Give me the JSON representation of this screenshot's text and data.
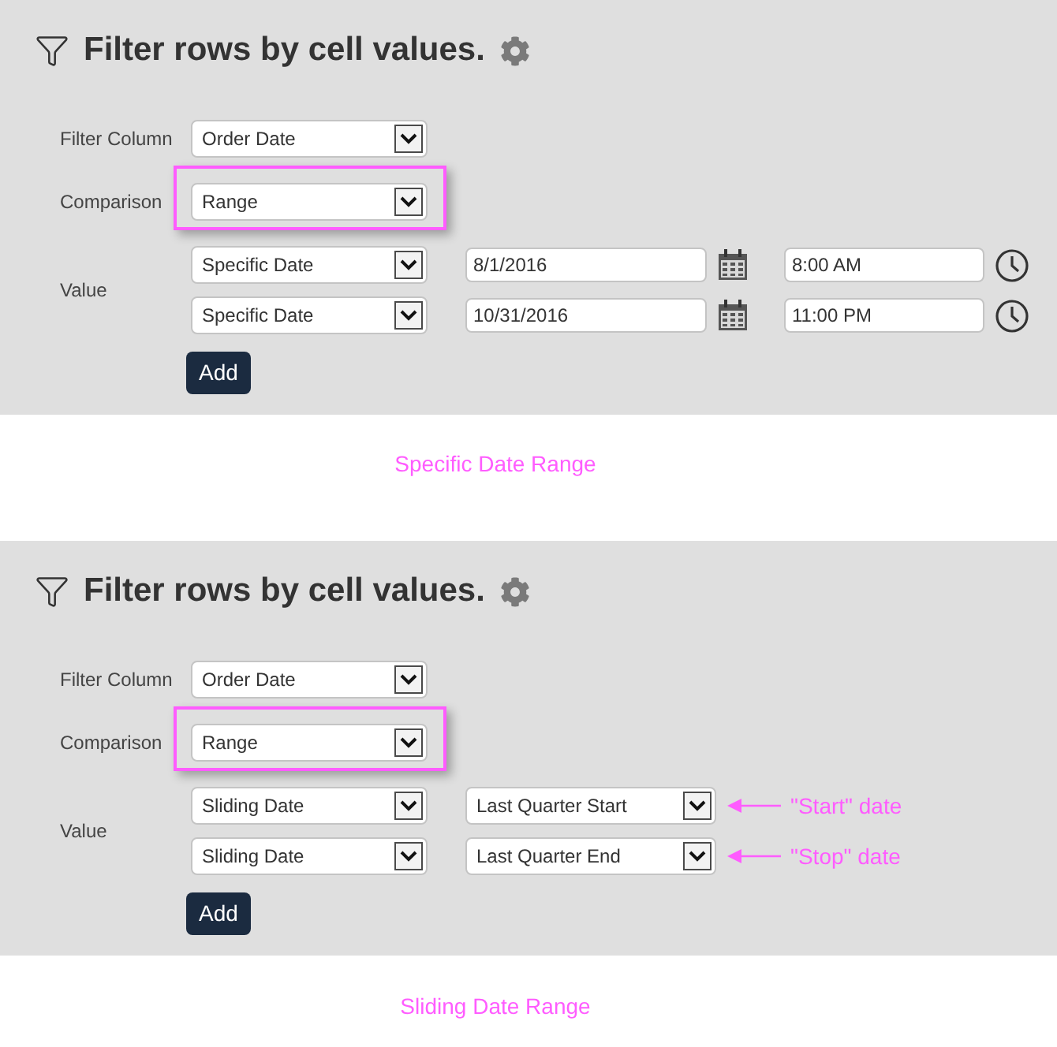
{
  "panels": [
    {
      "title": "Filter rows by cell values.",
      "fields": [
        {
          "label": "Filter Column",
          "value": "Order Date",
          "highlighted": false
        },
        {
          "label": "Comparison",
          "value": "Range",
          "highlighted": true
        }
      ],
      "value": {
        "label": "Value",
        "rows": [
          {
            "kind": "specific",
            "mode": "Specific Date",
            "date": "8/1/2016",
            "time": "8:00 AM"
          },
          {
            "kind": "specific",
            "mode": "Specific Date",
            "date": "10/31/2016",
            "time": "11:00 PM"
          }
        ]
      },
      "add_button": "Add",
      "caption": "Specific Date Range"
    },
    {
      "title": "Filter rows by cell values.",
      "fields": [
        {
          "label": "Filter Column",
          "value": "Order Date",
          "highlighted": false
        },
        {
          "label": "Comparison",
          "value": "Range",
          "highlighted": true
        }
      ],
      "value": {
        "label": "Value",
        "rows": [
          {
            "kind": "sliding",
            "mode": "Sliding Date",
            "preset": "Last Quarter Start",
            "note": "\"Start\" date"
          },
          {
            "kind": "sliding",
            "mode": "Sliding Date",
            "preset": "Last Quarter End",
            "note": "\"Stop\" date"
          }
        ]
      },
      "add_button": "Add",
      "caption": "Sliding Date Range"
    }
  ]
}
